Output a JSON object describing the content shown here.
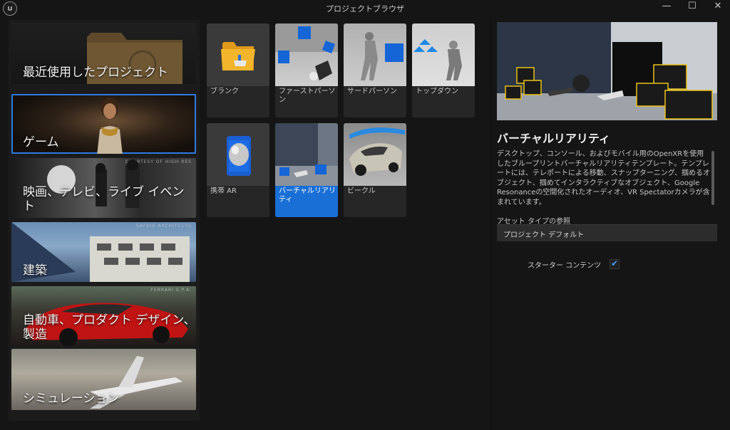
{
  "window": {
    "title": "プロジェクトブラウザ",
    "controls": {
      "minimize": "—",
      "maximize": "☐",
      "close": "✕"
    }
  },
  "categories": [
    {
      "label": "最近使用したプロジェクト",
      "selected": false
    },
    {
      "label": "ゲーム",
      "selected": true
    },
    {
      "label": "映画、テレビ、ライブ イベント",
      "selected": false,
      "credit": "COURTESY OF HIGH RES"
    },
    {
      "label": "建築",
      "selected": false,
      "credit": "SAFDIE ARCHITECTS"
    },
    {
      "label": "自動車、プロダクト デザイン、製造",
      "selected": false,
      "credit": "FERRARI S.P.A."
    },
    {
      "label": "シミュレーション",
      "selected": false
    }
  ],
  "templates": [
    {
      "label": "ブランク",
      "selected": false
    },
    {
      "label": "ファーストパーソン",
      "selected": false
    },
    {
      "label": "サードパーソン",
      "selected": false
    },
    {
      "label": "トップダウン",
      "selected": false
    },
    {
      "label": "携帯 AR",
      "selected": false
    },
    {
      "label": "バーチャルリアリティ",
      "selected": true
    },
    {
      "label": "ビークル",
      "selected": false
    }
  ],
  "details": {
    "title": "バーチャルリアリティ",
    "description": "デスクトップ、コンソール、およびモバイル用のOpenXRを使用したブループリントバーチャルリアリティテンプレート。テンプレートには、テレポートによる移動、スナップターニング、掴めるオブジェクト、掴めてインタラクティブなオブジェクト、Google Resonanceの空間化されたオーディオ、VR Spectatorカメラが含まれています。",
    "asset_type_label": "アセット タイプの参照",
    "asset_type_value": "プロジェクト デフォルト",
    "starter_content_label": "スターター コンテンツ",
    "starter_content_checked": true,
    "check_glyph": "✔"
  },
  "colors": {
    "accent": "#1a6fd6",
    "selection_outline": "#2d7be0",
    "yellow_edge": "#e8c21a"
  }
}
